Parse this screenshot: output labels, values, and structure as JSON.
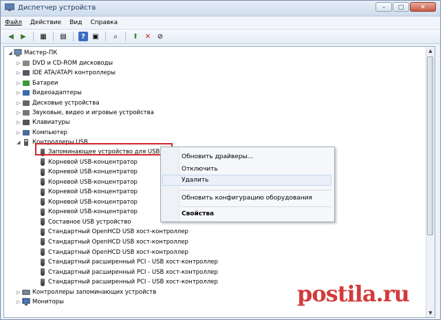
{
  "window": {
    "title": "Диспетчер устройств",
    "min": "–",
    "max": "□",
    "close": "✕"
  },
  "menu": {
    "file": "Файл",
    "action": "Действие",
    "view": "Вид",
    "help": "Справка"
  },
  "tree": {
    "root": "Мастер-ПК",
    "categories": [
      "DVD и CD-ROM дисководы",
      "IDE ATA/ATAPI контроллеры",
      "Батареи",
      "Видеоадаптеры",
      "Дисковые устройства",
      "Звуковые, видео и игровые устройства",
      "Клавиатуры",
      "Компьютер",
      "Контроллеры USB"
    ],
    "usb_devices": [
      "Запоминающее устройство для USB",
      "Корневой USB-концентратор",
      "Корневой USB-концентратор",
      "Корневой USB-концентратор",
      "Корневой USB-концентратор",
      "Корневой USB-концентратор",
      "Корневой USB-концентратор",
      "Составное USB устройство",
      "Стандартный OpenHCD USB хост-контроллер",
      "Стандартный OpenHCD USB хост-контроллер",
      "Стандартный OpenHCD USB хост-контроллер",
      "Стандартный расширенный PCI - USB хост-контроллер",
      "Стандартный расширенный PCI - USB хост-контроллер",
      "Стандартный расширенный PCI - USB хост-контроллер"
    ],
    "after": [
      "Контроллеры запоминающих устройств",
      "Мониторы"
    ]
  },
  "context_menu": {
    "update_drivers": "Обновить драйверы...",
    "disable": "Отключить",
    "delete": "Удалить",
    "scan": "Обновить конфигурацию оборудования",
    "properties": "Свойства"
  },
  "watermark": "postila.ru",
  "colors": {
    "highlight": "#d2232a",
    "watermark": "#d33b3b"
  }
}
